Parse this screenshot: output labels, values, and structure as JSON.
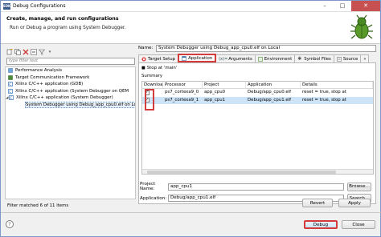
{
  "window": {
    "title": "Debug Configurations",
    "app_icon": "SDK",
    "minimize": "–",
    "maximize": "□",
    "close": "✕"
  },
  "header": {
    "title": "Create, manage, and run configurations",
    "subtitle": "Run or Debug a program using System Debugger."
  },
  "toolbar": {
    "icons": [
      "new-config-icon",
      "duplicate-icon",
      "delete-icon",
      "collapse-all-icon",
      "filter-icon"
    ]
  },
  "left": {
    "filter_placeholder": "type filter text",
    "tree": [
      {
        "label": "Performance Analysis",
        "icon": "perf-icon",
        "indent": 0
      },
      {
        "label": "Target Communication Framework",
        "icon": "tcf-icon",
        "indent": 0
      },
      {
        "label": "Xilinx C/C++ application (GDB)",
        "icon": "c-app-icon",
        "indent": 0
      },
      {
        "label": "Xilinx C/C++ application (System Debugger on QEM",
        "icon": "c-app-icon",
        "indent": 0
      },
      {
        "label": "Xilinx C/C++ application (System Debugger)",
        "icon": "c-app-icon",
        "indent": 0,
        "expanded": true
      },
      {
        "label": "System Debugger using Debug_app_cpu0.elf on Lo",
        "icon": "debug-config-icon",
        "indent": 1,
        "selected": true
      }
    ],
    "status": "Filter matched 6 of 11 items"
  },
  "right": {
    "name_label": "Name:",
    "name_value": "System Debugger using Debug_app_cpu0.elf on Local",
    "tabs": [
      "Target Setup",
      "Application",
      "Arguments",
      "Environment",
      "Symbol Files",
      "Source"
    ],
    "active_tab": "Application",
    "stop_at_main": "Stop at 'main'",
    "summary_label": "Summary",
    "columns": [
      "Download",
      "Processor",
      "Project",
      "Application",
      "Details"
    ],
    "rows": [
      {
        "download": "✓",
        "processor": "ps7_cortexa9_0",
        "project": "app_cpu0",
        "application": "Debug/app_cpu0.elf",
        "details": "reset = true, stop at"
      },
      {
        "download": "✓",
        "processor": "ps7_cortexa9_1",
        "project": "app_cpu1",
        "application": "Debug/app_cpu1.elf",
        "details": "reset = true, stop at"
      }
    ],
    "project_label": "Project Name:",
    "project_value": "app_cpu1",
    "application_label": "Application:",
    "application_value": "Debug/app_cpu1.elf",
    "browse": "Browse...",
    "search": "Search...",
    "revert": "Revert",
    "apply": "Apply"
  },
  "footer": {
    "help": "?",
    "debug": "Debug",
    "close": "Close"
  },
  "colors": {
    "highlight": "#d43b3b",
    "selection": "#cde3f7"
  }
}
